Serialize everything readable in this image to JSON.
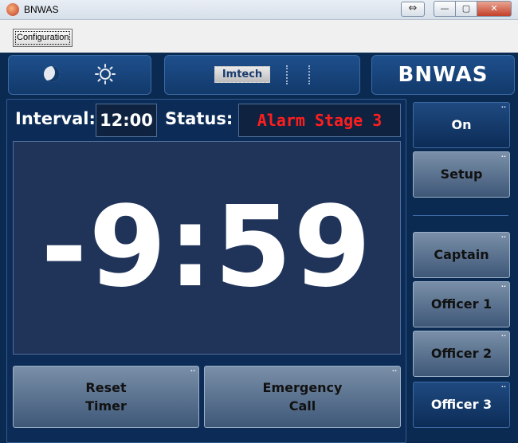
{
  "window": {
    "title": "BNWAS",
    "controls": {
      "extra": "⇔",
      "minimize": "—",
      "maximize": "▢",
      "close": "✕"
    }
  },
  "toolbar": {
    "configuration_label": "Configuration"
  },
  "header": {
    "logo_text": "Imtech",
    "brand": "BNWAS"
  },
  "status_bar": {
    "interval_label": "Interval:",
    "interval_value": "12:00",
    "status_label": "Status:",
    "status_value": "Alarm Stage 3"
  },
  "timer": {
    "value": "-9:59"
  },
  "actions": {
    "reset_label_line1": "Reset",
    "reset_label_line2": "Timer",
    "emergency_label_line1": "Emergency",
    "emergency_label_line2": "Call"
  },
  "side": {
    "buttons": [
      {
        "label": "On"
      },
      {
        "label": "Setup"
      },
      {
        "label": "Captain"
      },
      {
        "label": "Officer 1"
      },
      {
        "label": "Officer 2"
      },
      {
        "label": "Officer 3"
      }
    ]
  },
  "colors": {
    "background": "#0b2a52",
    "panel": "#20345a",
    "status_alarm": "#ff1e1e"
  }
}
